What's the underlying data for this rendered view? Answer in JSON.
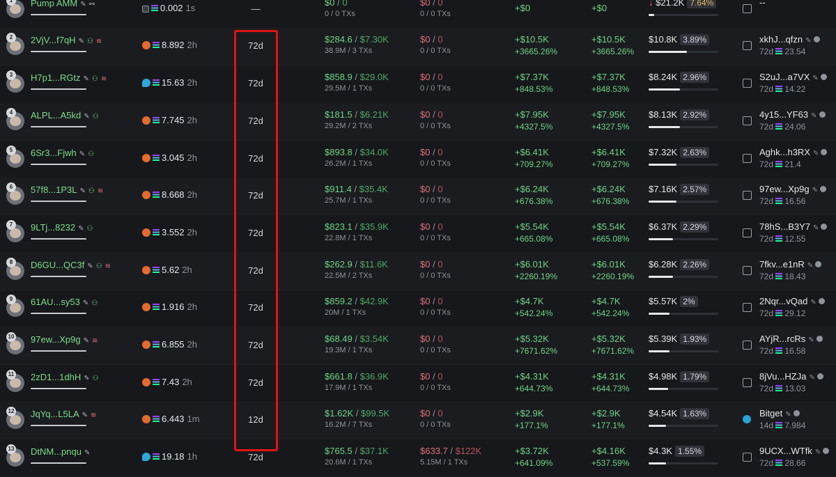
{
  "rows": [
    {
      "rank": "1",
      "trader": "Pump AMM",
      "trader_icons": [
        "edit",
        "link"
      ],
      "src": "box",
      "balance": "0.002",
      "bal_time": "1s",
      "age": "—",
      "bought": "$0 / 0",
      "bought_sub": "0 / 0 TXs",
      "sold": "$0 / 0",
      "sold_sub": "0 / 0 TXs",
      "pnl": "+$0",
      "pnl_pct": "",
      "upnl": "+$0",
      "upnl_pct": "",
      "remaining": "$21.2K",
      "remaining_prefix": "↓",
      "remaining_pct": "7.64%",
      "remaining_fill": 0.08,
      "funding_name": "--",
      "funding_sub": "",
      "funding_kind": "box"
    },
    {
      "rank": "2",
      "trader": "2VjV...f7qH",
      "trader_icons": [
        "edit",
        "user",
        "stack"
      ],
      "src": "orange",
      "balance": "8.892",
      "bal_time": "2h",
      "age": "72d",
      "bought": "$284.6 / $7.30K",
      "bought_sub": "38.9M / 3 TXs",
      "sold": "$0 / 0",
      "sold_sub": "0 / 0 TXs",
      "pnl": "+$10.5K",
      "pnl_pct": "+3665.26%",
      "upnl": "+$10.5K",
      "upnl_pct": "+3665.26%",
      "remaining": "$10.8K",
      "remaining_prefix": "",
      "remaining_pct": "3.89%",
      "remaining_fill": 0.55,
      "funding_name": "xkhJ...qfzn",
      "funding_sub": "72d 23.54",
      "funding_kind": "box"
    },
    {
      "rank": "3",
      "trader": "H7p1...RGtz",
      "trader_icons": [
        "edit",
        "user",
        "stack"
      ],
      "src": "fish",
      "balance": "15.63",
      "bal_time": "2h",
      "age": "72d",
      "bought": "$858.9 / $29.0K",
      "bought_sub": "29.5M / 1 TXs",
      "sold": "$0 / 0",
      "sold_sub": "0 / 0 TXs",
      "pnl": "+$7.37K",
      "pnl_pct": "+848.53%",
      "upnl": "+$7.37K",
      "upnl_pct": "+848.53%",
      "remaining": "$8.24K",
      "remaining_prefix": "",
      "remaining_pct": "2.96%",
      "remaining_fill": 0.45,
      "funding_name": "S2uJ...a7VX",
      "funding_sub": "72d 14.22",
      "funding_kind": "box"
    },
    {
      "rank": "4",
      "trader": "ALPL...A5kd",
      "trader_icons": [
        "edit",
        "user"
      ],
      "src": "orange",
      "balance": "7.745",
      "bal_time": "2h",
      "age": "72d",
      "bought": "$181.5 / $6.21K",
      "bought_sub": "29.2M / 2 TXs",
      "sold": "$0 / 0",
      "sold_sub": "0 / 0 TXs",
      "pnl": "+$7.95K",
      "pnl_pct": "+4327.5%",
      "upnl": "+$7.95K",
      "upnl_pct": "+4327.5%",
      "remaining": "$8.13K",
      "remaining_prefix": "",
      "remaining_pct": "2.92%",
      "remaining_fill": 0.45,
      "funding_name": "4y15...YF63",
      "funding_sub": "72d 24.06",
      "funding_kind": "box"
    },
    {
      "rank": "5",
      "trader": "6Sr3...Fjwh",
      "trader_icons": [
        "edit",
        "user"
      ],
      "src": "orange",
      "balance": "3.045",
      "bal_time": "2h",
      "age": "72d",
      "bought": "$893.8 / $34.0K",
      "bought_sub": "26.2M / 1 TXs",
      "sold": "$0 / 0",
      "sold_sub": "0 / 0 TXs",
      "pnl": "+$6.41K",
      "pnl_pct": "+709.27%",
      "upnl": "+$6.41K",
      "upnl_pct": "+709.27%",
      "remaining": "$7.32K",
      "remaining_prefix": "",
      "remaining_pct": "2.63%",
      "remaining_fill": 0.4,
      "funding_name": "Aghk...h3RX",
      "funding_sub": "72d 21.4",
      "funding_kind": "box"
    },
    {
      "rank": "6",
      "trader": "57f8...1P3L",
      "trader_icons": [
        "edit",
        "user",
        "stack"
      ],
      "src": "orange",
      "balance": "8.668",
      "bal_time": "2h",
      "age": "72d",
      "bought": "$911.4 / $35.4K",
      "bought_sub": "25.7M / 1 TXs",
      "sold": "$0 / 0",
      "sold_sub": "0 / 0 TXs",
      "pnl": "+$6.24K",
      "pnl_pct": "+676.38%",
      "upnl": "+$6.24K",
      "upnl_pct": "+676.38%",
      "remaining": "$7.16K",
      "remaining_prefix": "",
      "remaining_pct": "2.57%",
      "remaining_fill": 0.4,
      "funding_name": "97ew...Xp9g",
      "funding_sub": "72d 16.56",
      "funding_kind": "box"
    },
    {
      "rank": "7",
      "trader": "9LTj...8232",
      "trader_icons": [
        "edit",
        "user"
      ],
      "src": "orange",
      "balance": "3.552",
      "bal_time": "2h",
      "age": "72d",
      "bought": "$823.1 / $35.9K",
      "bought_sub": "22.8M / 1 TXs",
      "sold": "$0 / 0",
      "sold_sub": "0 / 0 TXs",
      "pnl": "+$5.54K",
      "pnl_pct": "+665.08%",
      "upnl": "+$5.54K",
      "upnl_pct": "+665.08%",
      "remaining": "$6.37K",
      "remaining_prefix": "",
      "remaining_pct": "2.29%",
      "remaining_fill": 0.35,
      "funding_name": "78hS...B3Y7",
      "funding_sub": "72d 12.55",
      "funding_kind": "box"
    },
    {
      "rank": "8",
      "trader": "D6GU...QC3f",
      "trader_icons": [
        "edit",
        "user",
        "stack"
      ],
      "src": "orange",
      "balance": "5.62",
      "bal_time": "2h",
      "age": "72d",
      "bought": "$262.9 / $11.6K",
      "bought_sub": "22.5M / 2 TXs",
      "sold": "$0 / 0",
      "sold_sub": "0 / 0 TXs",
      "pnl": "+$6.01K",
      "pnl_pct": "+2260.19%",
      "upnl": "+$6.01K",
      "upnl_pct": "+2260.19%",
      "remaining": "$6.28K",
      "remaining_prefix": "",
      "remaining_pct": "2.26%",
      "remaining_fill": 0.35,
      "funding_name": "7fkv...e1nR",
      "funding_sub": "72d 18.43",
      "funding_kind": "box"
    },
    {
      "rank": "9",
      "trader": "61AU...sy53",
      "trader_icons": [
        "edit",
        "user"
      ],
      "src": "orange",
      "balance": "1.916",
      "bal_time": "2h",
      "age": "72d",
      "bought": "$859.2 / $42.9K",
      "bought_sub": "20M / 1 TXs",
      "sold": "$0 / 0",
      "sold_sub": "0 / 0 TXs",
      "pnl": "+$4.7K",
      "pnl_pct": "+542.24%",
      "upnl": "+$4.7K",
      "upnl_pct": "+542.24%",
      "remaining": "$5.57K",
      "remaining_prefix": "",
      "remaining_pct": "2%",
      "remaining_fill": 0.3,
      "funding_name": "2Nqr...vQad",
      "funding_sub": "72d 29.12",
      "funding_kind": "box"
    },
    {
      "rank": "10",
      "trader": "97ew...Xp9g",
      "trader_icons": [
        "edit",
        "stack"
      ],
      "src": "orange",
      "balance": "6.855",
      "bal_time": "2h",
      "age": "72d",
      "bought": "$68.49 / $3.54K",
      "bought_sub": "19.3M / 1 TXs",
      "sold": "$0 / 0",
      "sold_sub": "0 / 0 TXs",
      "pnl": "+$5.32K",
      "pnl_pct": "+7671.62%",
      "upnl": "+$5.32K",
      "upnl_pct": "+7671.62%",
      "remaining": "$5.39K",
      "remaining_prefix": "",
      "remaining_pct": "1.93%",
      "remaining_fill": 0.3,
      "funding_name": "AYjR...rcRs",
      "funding_sub": "72d 16.58",
      "funding_kind": "box"
    },
    {
      "rank": "11",
      "trader": "2zD1...1dhH",
      "trader_icons": [
        "edit",
        "user"
      ],
      "src": "orange",
      "balance": "7.43",
      "bal_time": "2h",
      "age": "72d",
      "bought": "$661.8 / $36.9K",
      "bought_sub": "17.9M / 1 TXs",
      "sold": "$0 / 0",
      "sold_sub": "0 / 0 TXs",
      "pnl": "+$4.31K",
      "pnl_pct": "+644.73%",
      "upnl": "+$4.31K",
      "upnl_pct": "+644.73%",
      "remaining": "$4.98K",
      "remaining_prefix": "",
      "remaining_pct": "1.79%",
      "remaining_fill": 0.28,
      "funding_name": "8jVu...HZJa",
      "funding_sub": "72d 13.03",
      "funding_kind": "box"
    },
    {
      "rank": "12",
      "trader": "JqYq...L5LA",
      "trader_icons": [
        "edit",
        "stack"
      ],
      "src": "orange",
      "balance": "6.443",
      "bal_time": "1m",
      "age": "12d",
      "bought": "$1.62K / $99.5K",
      "bought_sub": "16.2M / 7 TXs",
      "sold": "$0 / 0",
      "sold_sub": "0 / 0 TXs",
      "pnl": "+$2.9K",
      "pnl_pct": "+177.1%",
      "upnl": "+$2.9K",
      "upnl_pct": "+177.1%",
      "remaining": "$4.54K",
      "remaining_prefix": "",
      "remaining_pct": "1.63%",
      "remaining_fill": 0.25,
      "funding_name": "Bitget",
      "funding_sub": "14d 7.984",
      "funding_kind": "bitget"
    },
    {
      "rank": "13",
      "trader": "DtNM...pnqu",
      "trader_icons": [
        "edit"
      ],
      "src": "fish",
      "balance": "19.18",
      "bal_time": "1h",
      "age": "72d",
      "bought": "$765.5 / $37.1K",
      "bought_sub": "20.6M / 1 TXs",
      "sold": "$633.7 / $122K",
      "sold_sub": "5.15M / 1 TXs",
      "pnl": "+$3.72K",
      "pnl_pct": "+641.09%",
      "upnl": "+$4.16K",
      "upnl_pct": "+537.59%",
      "remaining": "$4.3K",
      "remaining_prefix": "",
      "remaining_pct": "1.55%",
      "remaining_fill": 0.25,
      "funding_name": "9UCX...WTfk",
      "funding_sub": "72d 28.66",
      "funding_kind": "box"
    }
  ],
  "highlight": {
    "color": "#e01414",
    "column": "age"
  }
}
